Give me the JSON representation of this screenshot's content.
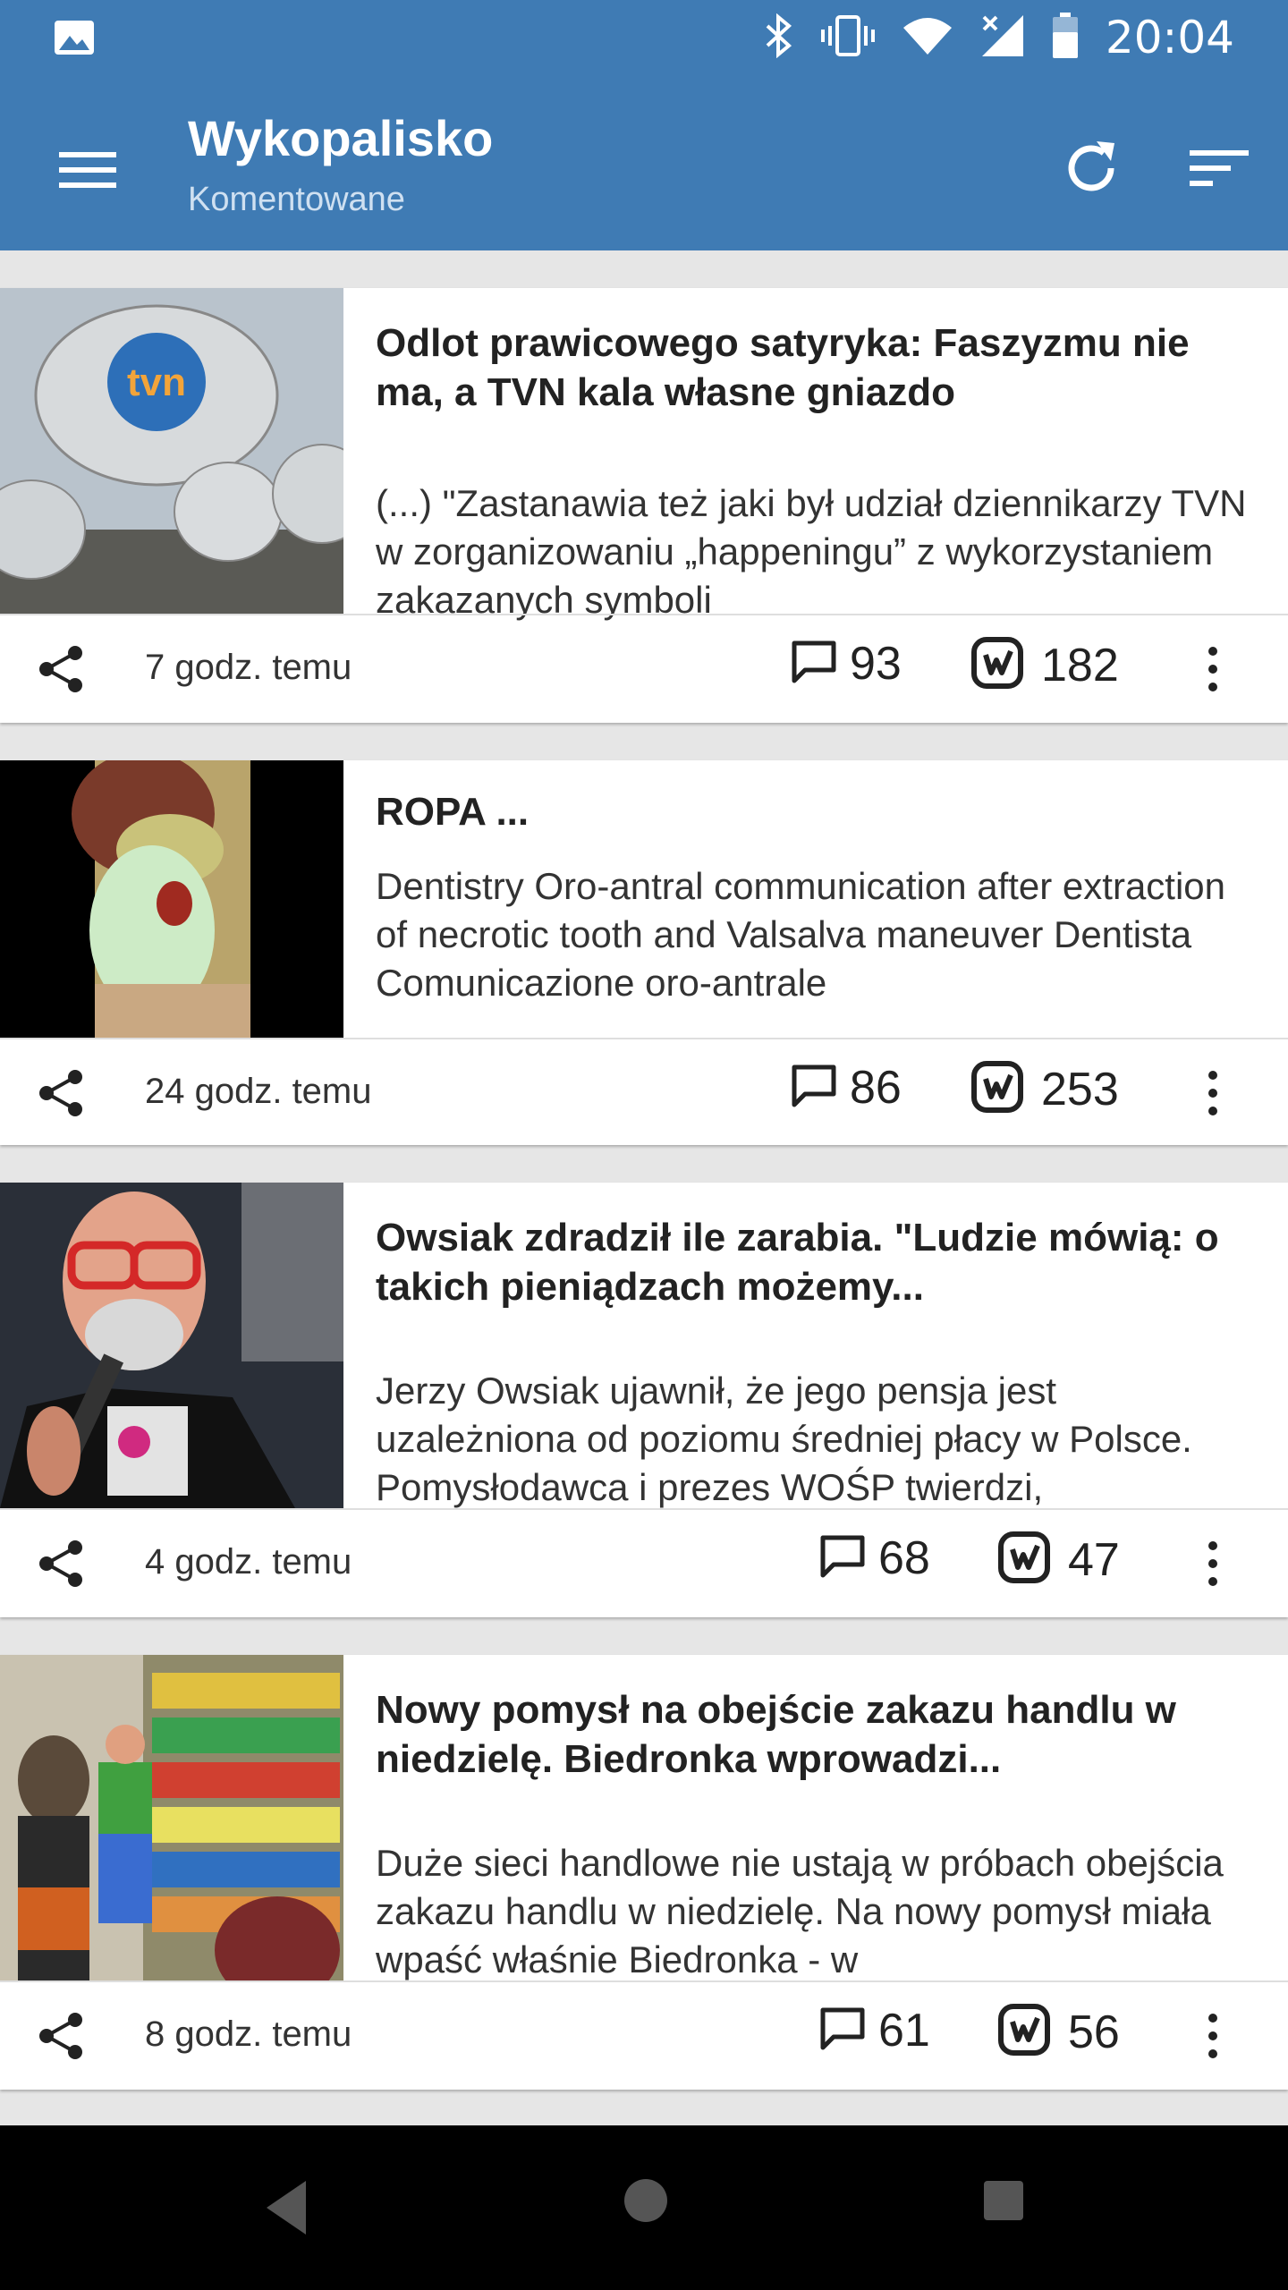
{
  "status_bar": {
    "time": "20:04",
    "icons": [
      "image-icon",
      "bluetooth-icon",
      "vibrate-icon",
      "wifi-icon",
      "signal-icon",
      "battery-icon"
    ]
  },
  "app_bar": {
    "title": "Wykopalisko",
    "subtitle": "Komentowane",
    "icons": [
      "menu-icon",
      "refresh-icon",
      "filter-icon"
    ]
  },
  "cards": [
    {
      "title": "Odlot prawicowego satyryka: Faszyzmu nie ma, a TVN kala własne gniazdo",
      "description": "(...) \"Zastanawia też jaki był udział dziennikarzy TVN w zorganizowaniu „happeningu” z wykorzystaniem zakazanych symboli",
      "time": "7 godz. temu",
      "comments": "93",
      "votes": "182",
      "thumb_text": "tvn"
    },
    {
      "title": "ROPA ...",
      "description": "Dentistry Oro-antral communication after extraction of necrotic tooth and Valsalva maneuver Dentista Comunicazione oro-antrale",
      "time": "24 godz. temu",
      "comments": "86",
      "votes": "253"
    },
    {
      "title": "Owsiak zdradził ile zarabia. \"Ludzie mówią: o takich pieniądzach możemy...",
      "description": "Jerzy Owsiak ujawnił, że jego pensja jest uzależniona od poziomu średniej płacy w Polsce. Pomysłodawca i prezes WOŚP twierdzi,",
      "time": "4 godz. temu",
      "comments": "68",
      "votes": "47"
    },
    {
      "title": "Nowy pomysł na obejście zakazu handlu w niedzielę. Biedronka wprowadzi...",
      "description": "Duże sieci handlowe nie ustają w próbach obejścia zakazu handlu w niedzielę. Na nowy pomysł miała wpaść właśnie Biedronka - w",
      "time": "8 godz. temu",
      "comments": "61",
      "votes": "56"
    }
  ],
  "colors": {
    "app_bar": "#3f7bb4",
    "background": "#e6e6e6",
    "card": "#ffffff"
  }
}
